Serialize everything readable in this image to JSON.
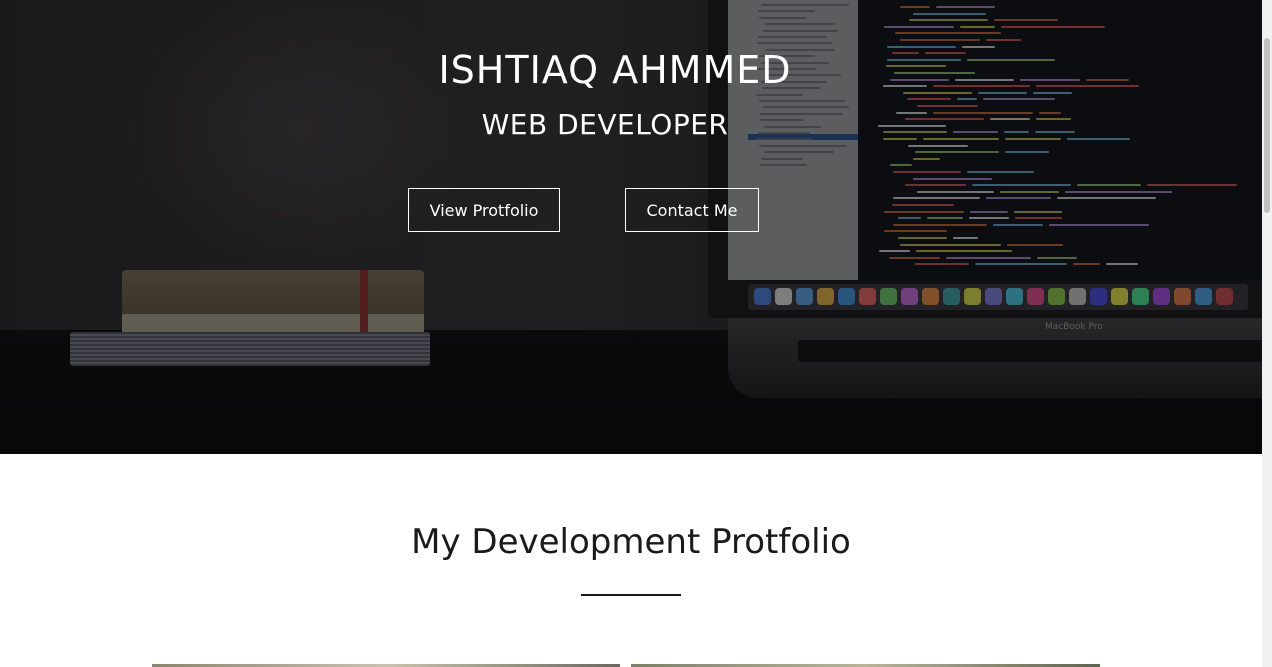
{
  "hero": {
    "name": "ISHTIAQ AHMMED",
    "role": "WEB DEVELOPER",
    "buttons": {
      "portfolio_label": "View Protfolio",
      "contact_label": "Contact Me"
    },
    "laptop_label": "MacBook Pro"
  },
  "portfolio": {
    "title": "My Development Protfolio"
  },
  "colors": {
    "hero_text": "#ffffff",
    "section_text": "#1a1a1a",
    "background": "#ffffff"
  }
}
